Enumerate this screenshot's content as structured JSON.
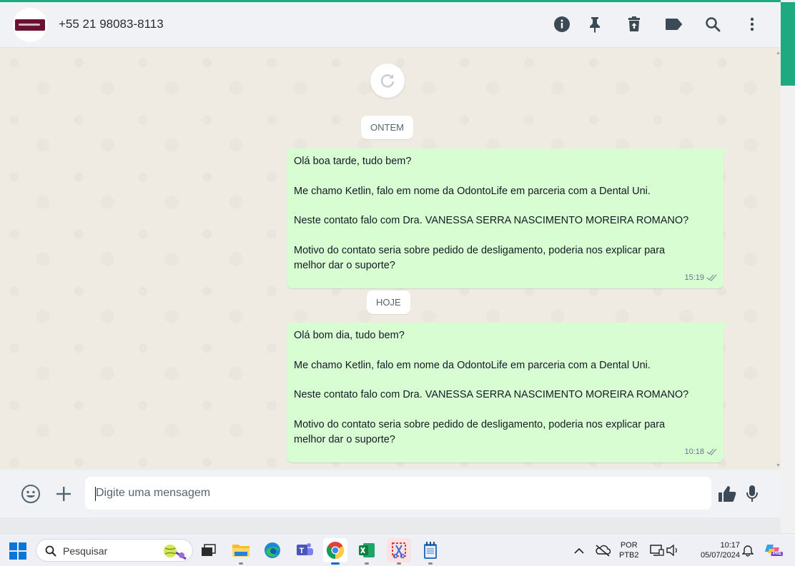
{
  "header": {
    "contact_name": "+55 21 98083-8113",
    "icons": [
      "info-icon",
      "pin-icon",
      "delete-icon",
      "label-icon",
      "search-icon",
      "more-icon"
    ]
  },
  "chat": {
    "date_chips": [
      "ONTEM",
      "HOJE"
    ],
    "messages": [
      {
        "lines": [
          "Olá boa tarde, tudo bem?",
          "",
          "Me chamo Ketlin, falo em nome da OdontoLife em parceria com a Dental Uni.",
          "",
          "Neste contato falo com Dra. VANESSA SERRA NASCIMENTO MOREIRA ROMANO?",
          "",
          "Motivo do contato seria sobre pedido de desligamento, poderia nos explicar para",
          "melhor dar o suporte?"
        ],
        "time": "15:19"
      },
      {
        "lines": [
          "Olá bom dia, tudo bem?",
          "",
          "Me chamo Ketlin, falo em nome da OdontoLife em parceria com a Dental Uni.",
          "",
          "Neste contato falo com Dra. VANESSA SERRA NASCIMENTO MOREIRA ROMANO?",
          "",
          "Motivo do contato seria sobre pedido de desligamento, poderia nos explicar para",
          "melhor dar o suporte?"
        ],
        "time": "10:18"
      }
    ]
  },
  "composer": {
    "placeholder": "Digite uma mensagem"
  },
  "taskbar": {
    "search_label": "Pesquisar",
    "lang_top": "POR",
    "lang_bottom": "PTB2",
    "time": "10:17",
    "date": "05/07/2024",
    "copilot_badge": "PRE"
  },
  "colors": {
    "outgoing_bubble": "#d9fdd3",
    "accent": "#1fa980",
    "chat_background": "#efeae2"
  }
}
